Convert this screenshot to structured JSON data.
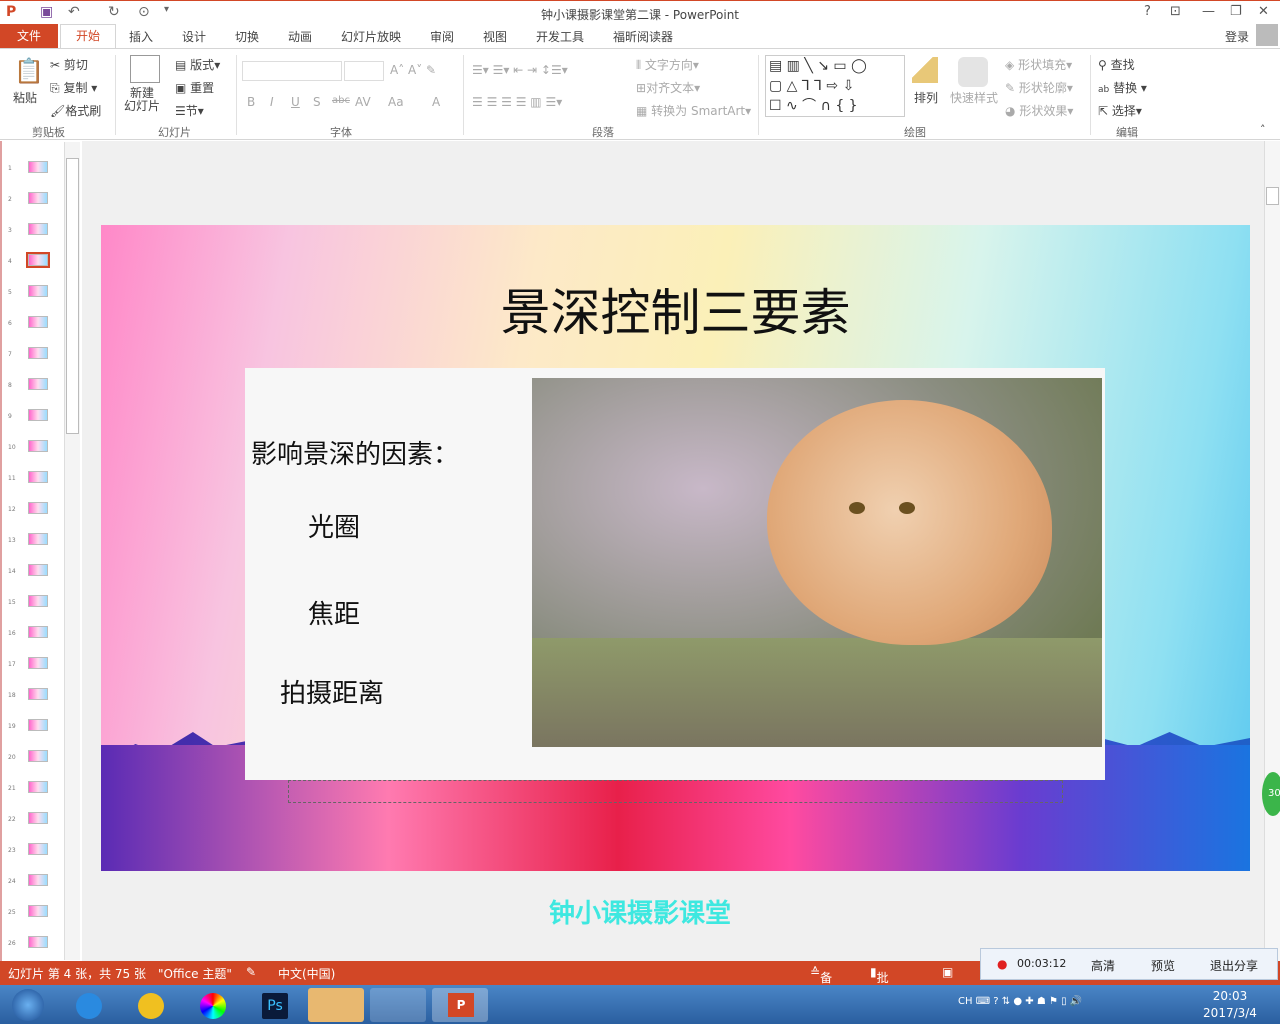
{
  "window": {
    "title": "钟小课摄影课堂第二课 - PowerPoint",
    "help": "?",
    "login": "登录"
  },
  "tabs": [
    "文件",
    "开始",
    "插入",
    "设计",
    "切换",
    "动画",
    "幻灯片放映",
    "审阅",
    "视图",
    "开发工具",
    "福昕阅读器"
  ],
  "ribbon": {
    "clipboard": {
      "paste": "粘贴",
      "cut": "剪切",
      "copy": "复制",
      "format_painter": "格式刷",
      "group": "剪贴板"
    },
    "slides": {
      "new_slide": "新建\n幻灯片",
      "layout": "版式",
      "reset": "重置",
      "section": "节",
      "group": "幻灯片"
    },
    "font": {
      "bold": "B",
      "italic": "I",
      "underline": "U",
      "shadow": "S",
      "strike": "abc",
      "spacing": "AV",
      "case": "Aa",
      "color": "A",
      "group": "字体"
    },
    "paragraph": {
      "text_direction": "文字方向",
      "align_text": "对齐文本",
      "smartart": "转换为 SmartArt",
      "group": "段落"
    },
    "drawing": {
      "arrange": "排列",
      "quick_styles": "快速样式",
      "fill": "形状填充",
      "outline": "形状轮廓",
      "effects": "形状效果",
      "group": "绘图"
    },
    "editing": {
      "find": "查找",
      "replace": "替换",
      "select": "选择",
      "group": "编辑"
    }
  },
  "thumbnails": {
    "current": 4,
    "count_visible": 26
  },
  "slide": {
    "title": "景深控制三要素",
    "heading": "影响景深的因素：",
    "items": [
      "光圈",
      "焦距",
      "拍摄距离"
    ]
  },
  "footer_text": "钟小课摄影课堂",
  "status": {
    "slide_info": "幻灯片 第 4 张，共 75 张",
    "theme": "\"Office 主题\"",
    "language": "中文(中国)",
    "notes": "备注",
    "comments": "批注"
  },
  "share_bar": {
    "timer": "00:03:12",
    "hd": "高清",
    "preview": "预览",
    "exit": "退出分享",
    "record_color": "#e02020"
  },
  "badge": "30",
  "taskbar": {
    "ime": "CH",
    "time": "20:03",
    "date": "2017/3/4"
  },
  "colors": {
    "accent": "#d24726",
    "footer_text": "#3ee8e0"
  }
}
